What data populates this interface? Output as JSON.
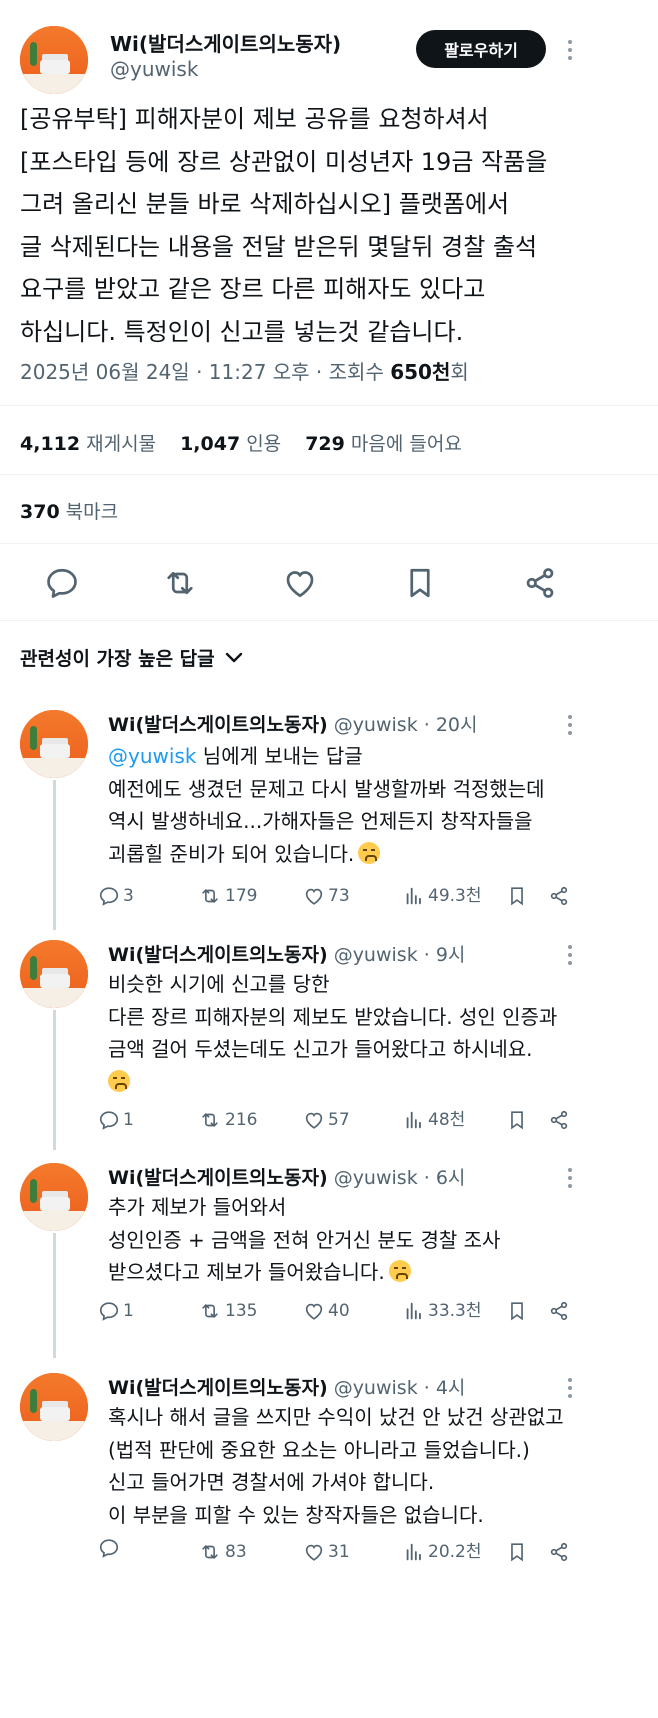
{
  "post": {
    "author_name": "Wi(발더스게이트의노동자)",
    "author_handle": "@yuwisk",
    "follow_label": "팔로우하기",
    "text_lines": [
      "[공유부탁] 피해자분이 제보 공유를 요청하셔서",
      "[포스타입 등에 장르 상관없이 미성년자 19금 작품을",
      "그려 올리신 분들 바로 삭제하십시오] 플랫폼에서",
      "글 삭제된다는 내용을 전달 받은뒤 몇달뒤 경찰 출석",
      "요구를 받았고 같은 장르 다른 피해자도 있다고",
      "하십니다. 특정인이 신고를 넣는것 같습니다."
    ],
    "meta_prefix": "2025년 06월 24일 · 11:27 오후 · 조회수 ",
    "views_count": "650천",
    "views_suffix": "회",
    "stats": {
      "reposts": "4,112",
      "reposts_label": "재게시물",
      "quotes": "1,047",
      "quotes_label": "인용",
      "likes": "729",
      "likes_label": "마음에 들어요",
      "bookmarks": "370",
      "bookmarks_label": "북마크"
    },
    "action_icons": [
      "reply-icon",
      "repost-icon",
      "like-icon",
      "bookmark-icon",
      "share-icon"
    ]
  },
  "replies_sort_label": "관련성이 가장 높은 답글",
  "replies": [
    {
      "name": "Wi(발더스게이트의노동자)",
      "handle_time": "@yuwisk · 20시",
      "mention": "@yuwisk",
      "mention_suffix": " 님에게 보내는 답글",
      "lines": [
        "예전에도 생겼던 문제고 다시 발생할까봐 걱정했는데",
        "역시 발생하네요...가해자들은 언제든지 창작자들을",
        "괴롭힐 준비가 되어 있습니다."
      ],
      "emoji_after_line": 3,
      "replies": "3",
      "reposts": "179",
      "likes": "73",
      "views": "49.3천"
    },
    {
      "name": "Wi(발더스게이트의노동자)",
      "handle_time": "@yuwisk · 9시",
      "lines": [
        "비슷한 시기에 신고를 당한",
        "다른 장르 피해자분의 제보도 받았습니다. 성인 인증과",
        "금액 걸어 두셨는데도 신고가 들어왔다고 하시네요."
      ],
      "emoji_own_line": true,
      "replies": "1",
      "reposts": "216",
      "likes": "57",
      "views": "48천"
    },
    {
      "name": "Wi(발더스게이트의노동자)",
      "handle_time": "@yuwisk · 6시",
      "lines": [
        "추가 제보가 들어와서",
        "성인인증 + 금액을 전혀 안거신 분도 경찰 조사",
        "받으셨다고 제보가 들어왔습니다."
      ],
      "emoji_after_line": 3,
      "replies": "1",
      "reposts": "135",
      "likes": "40",
      "views": "33.3천"
    },
    {
      "name": "Wi(발더스게이트의노동자)",
      "handle_time": "@yuwisk · 4시",
      "lines": [
        "혹시나 해서 글을 쓰지만 수익이 났건 안 났건 상관없고",
        "(법적 판단에 중요한 요소는 아니라고 들었습니다.)",
        "신고 들어가면 경찰서에 가셔야 합니다.",
        "이 부분을 피할 수 있는 창작자들은 없습니다."
      ],
      "replies": "",
      "reposts": "83",
      "likes": "31",
      "views": "20.2천"
    }
  ]
}
